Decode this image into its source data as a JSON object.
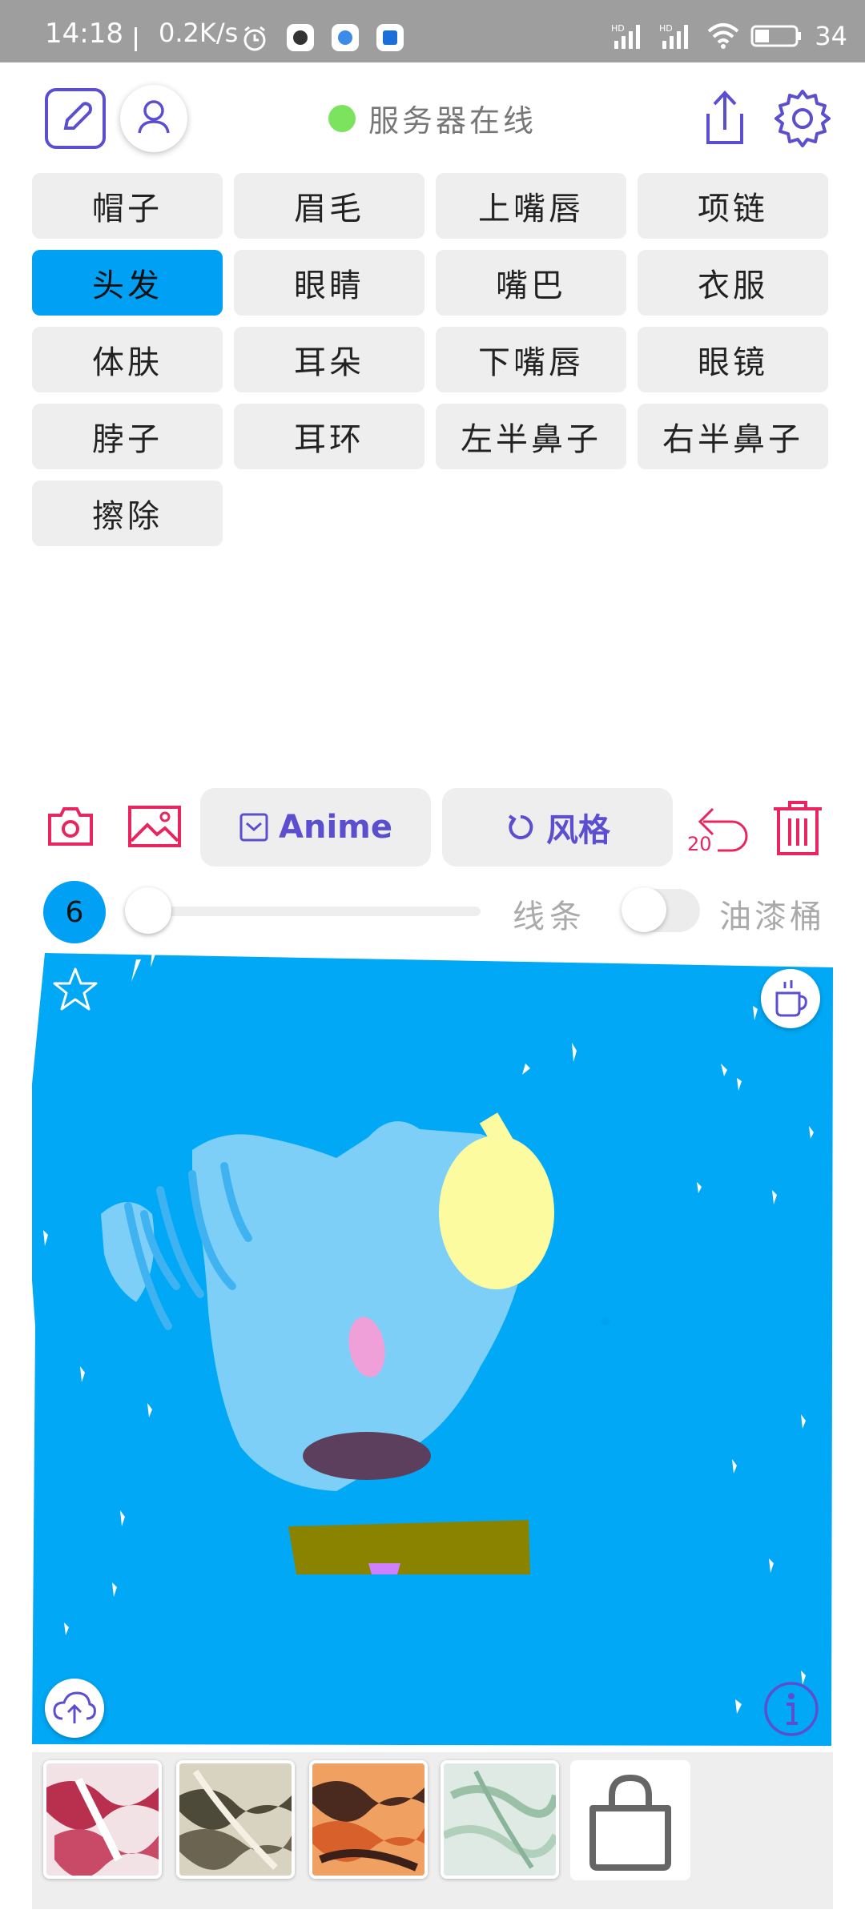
{
  "status_bar": {
    "time": "14:18",
    "net_speed": "0.2K/s",
    "battery": "34"
  },
  "header": {
    "server_status": "服务器在线",
    "status_color": "#7ce35f"
  },
  "categories": [
    {
      "label": "帽子",
      "active": false
    },
    {
      "label": "眉毛",
      "active": false
    },
    {
      "label": "上嘴唇",
      "active": false
    },
    {
      "label": "项链",
      "active": false
    },
    {
      "label": "头发",
      "active": true
    },
    {
      "label": "眼睛",
      "active": false
    },
    {
      "label": "嘴巴",
      "active": false
    },
    {
      "label": "衣服",
      "active": false
    },
    {
      "label": "体肤",
      "active": false
    },
    {
      "label": "耳朵",
      "active": false
    },
    {
      "label": "下嘴唇",
      "active": false
    },
    {
      "label": "眼镜",
      "active": false
    },
    {
      "label": "脖子",
      "active": false
    },
    {
      "label": "耳环",
      "active": false
    },
    {
      "label": "左半鼻子",
      "active": false
    },
    {
      "label": "右半鼻子",
      "active": false
    },
    {
      "label": "擦除",
      "active": false
    }
  ],
  "toolbar": {
    "anime_label": "Anime",
    "style_label": "风格",
    "undo_count": "20",
    "accent_color": "#e8255f",
    "purple": "#5b4fcf"
  },
  "brush": {
    "size": "6",
    "lines_label": "线条",
    "bucket_label": "油漆桶"
  },
  "colors": {
    "selected": "#00a0f4",
    "canvas_bg": "#00a8f5"
  }
}
